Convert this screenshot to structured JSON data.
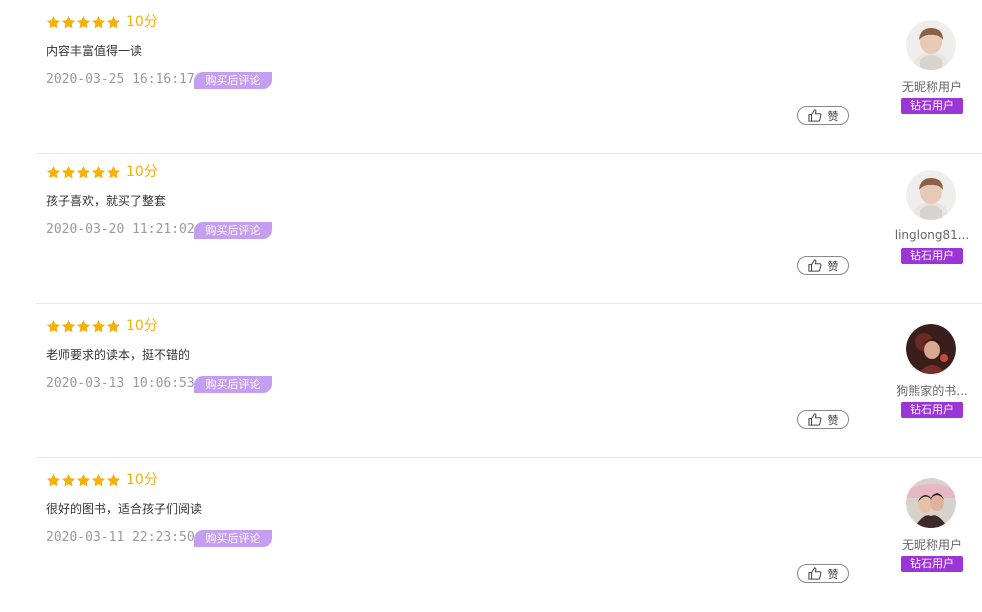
{
  "reviews": [
    {
      "score": "10分",
      "content": "内容丰富值得一读",
      "date": "2020-03-25 16:16:17",
      "badge": "购买后评论",
      "like_label": "赞",
      "username": "无昵称用户",
      "vip_label": "钻石用户",
      "avatar": "default-avatar",
      "rating_stars": 5
    },
    {
      "score": "10分",
      "content": "孩子喜欢，就买了整套",
      "date": "2020-03-20 11:21:02",
      "badge": "购买后评论",
      "like_label": "赞",
      "username": "linglong81...",
      "vip_label": "钻石用户",
      "avatar": "default-avatar",
      "rating_stars": 5
    },
    {
      "score": "10分",
      "content": "老师要求的读本，挺不错的",
      "date": "2020-03-13 10:06:53",
      "badge": "购买后评论",
      "like_label": "赞",
      "username": "狗熊家的书...",
      "vip_label": "钻石用户",
      "avatar": "photo-avatar",
      "rating_stars": 5
    },
    {
      "score": "10分",
      "content": "很好的图书，适合孩子们阅读",
      "date": "2020-03-11 22:23:50",
      "badge": "购买后评论",
      "like_label": "赞",
      "username": "无昵称用户",
      "vip_label": "钻石用户",
      "avatar": "photo-avatar",
      "rating_stars": 5
    }
  ],
  "colors": {
    "star": "#f5b20c",
    "badge": "#c59ef2",
    "vip": "#9c35d8"
  }
}
